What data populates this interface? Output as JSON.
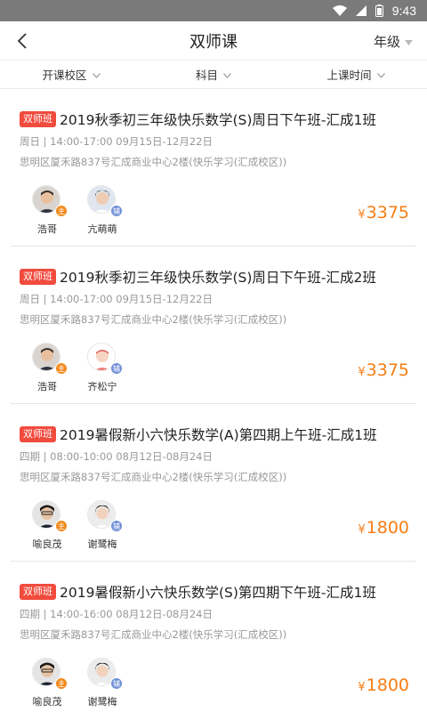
{
  "status_bar": {
    "time": "9:43",
    "icons": [
      "wifi-icon",
      "signal-icon",
      "battery-icon"
    ]
  },
  "nav": {
    "title": "双师课",
    "grade_label": "年级"
  },
  "filters": [
    {
      "label": "开课校区"
    },
    {
      "label": "科目"
    },
    {
      "label": "上课时间"
    }
  ],
  "colors": {
    "badge": "#f04b3d",
    "price": "#f77d14",
    "main_teacher": "#f28a1c",
    "assistant_teacher": "#6f8fd6"
  },
  "courses": [
    {
      "badge": "双师班",
      "title": "2019秋季初三年级快乐数学(S)周日下午班-汇成1班",
      "time": "周日 | 14:00-17:00 09月15日-12月22日",
      "address": "思明区厦禾路837号汇成商业中心2楼(快乐学习(汇成校区))",
      "teachers": [
        {
          "name": "浩哥",
          "role": "主"
        },
        {
          "name": "亢萌萌",
          "role": "辅"
        }
      ],
      "price_symbol": "¥",
      "price": "3375"
    },
    {
      "badge": "双师班",
      "title": "2019秋季初三年级快乐数学(S)周日下午班-汇成2班",
      "time": "周日 | 14:00-17:00 09月15日-12月22日",
      "address": "思明区厦禾路837号汇成商业中心2楼(快乐学习(汇成校区))",
      "teachers": [
        {
          "name": "浩哥",
          "role": "主"
        },
        {
          "name": "齐松宁",
          "role": "辅"
        }
      ],
      "price_symbol": "¥",
      "price": "3375"
    },
    {
      "badge": "双师班",
      "title": "2019暑假新小六快乐数学(A)第四期上午班-汇成1班",
      "time": "四期 | 08:00-10:00 08月12日-08月24日",
      "address": "思明区厦禾路837号汇成商业中心2楼(快乐学习(汇成校区))",
      "teachers": [
        {
          "name": "喻良茂",
          "role": "主"
        },
        {
          "name": "谢鹭梅",
          "role": "辅"
        }
      ],
      "price_symbol": "¥",
      "price": "1800"
    },
    {
      "badge": "双师班",
      "title": "2019暑假新小六快乐数学(S)第四期下午班-汇成1班",
      "time": "四期 | 14:00-16:00 08月12日-08月24日",
      "address": "思明区厦禾路837号汇成商业中心2楼(快乐学习(汇成校区))",
      "teachers": [
        {
          "name": "喻良茂",
          "role": "主"
        },
        {
          "name": "谢鹭梅",
          "role": "辅"
        }
      ],
      "price_symbol": "¥",
      "price": "1800"
    }
  ]
}
